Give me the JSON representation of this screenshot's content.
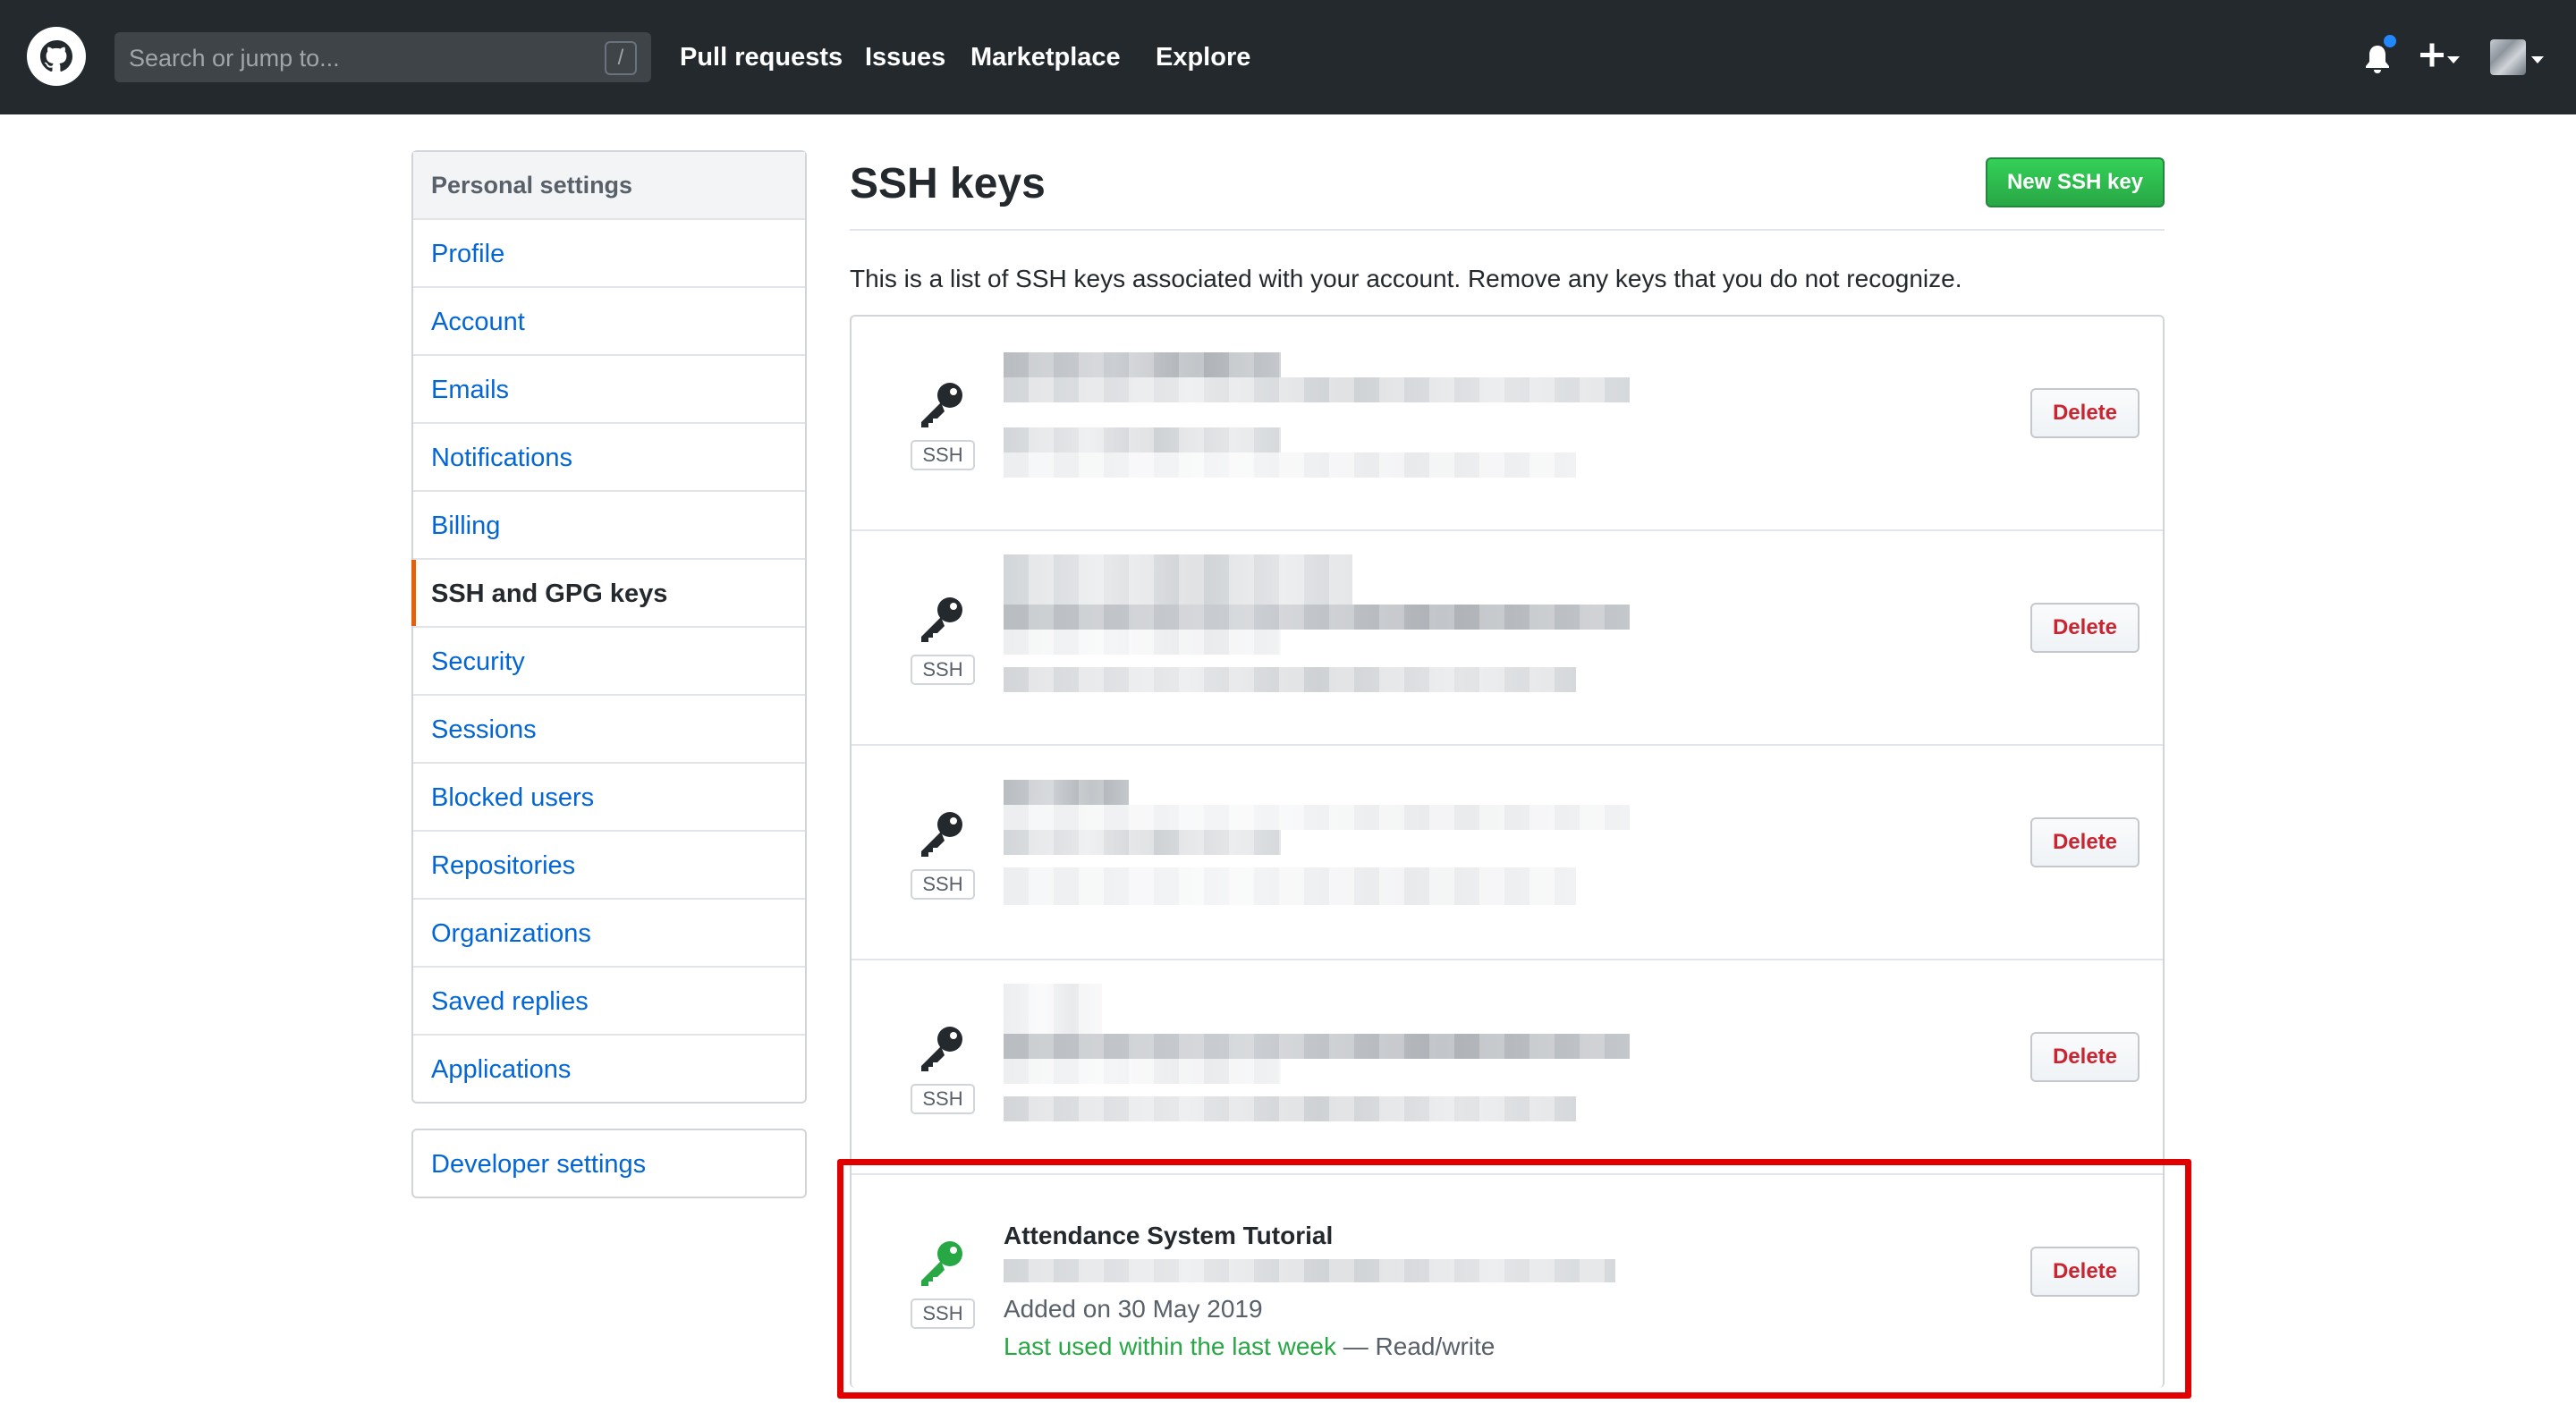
{
  "header": {
    "search_placeholder": "Search or jump to...",
    "search_shortcut": "/",
    "nav": [
      "Pull requests",
      "Issues",
      "Marketplace",
      "Explore"
    ]
  },
  "sidebar": {
    "heading": "Personal settings",
    "items": [
      {
        "label": "Profile"
      },
      {
        "label": "Account"
      },
      {
        "label": "Emails"
      },
      {
        "label": "Notifications"
      },
      {
        "label": "Billing"
      },
      {
        "label": "SSH and GPG keys",
        "active": true
      },
      {
        "label": "Security"
      },
      {
        "label": "Sessions"
      },
      {
        "label": "Blocked users"
      },
      {
        "label": "Repositories"
      },
      {
        "label": "Organizations"
      },
      {
        "label": "Saved replies"
      },
      {
        "label": "Applications"
      }
    ],
    "developer_settings": "Developer settings"
  },
  "main": {
    "title": "SSH keys",
    "new_key_button": "New SSH key",
    "intro": "This is a list of SSH keys associated with your account. Remove any keys that you do not recognize.",
    "keys": [
      {
        "type_label": "SSH",
        "delete_label": "Delete",
        "redacted": true
      },
      {
        "type_label": "SSH",
        "delete_label": "Delete",
        "redacted": true
      },
      {
        "type_label": "SSH",
        "delete_label": "Delete",
        "redacted": true
      },
      {
        "type_label": "SSH",
        "delete_label": "Delete",
        "redacted": true
      },
      {
        "type_label": "SSH",
        "delete_label": "Delete",
        "name": "Attendance System Tutorial",
        "added": "Added on 30 May 2019",
        "last_used": "Last used within the last week",
        "access": " — Read/write"
      }
    ]
  },
  "colors": {
    "header_bg": "#24292e",
    "link": "#0366d6",
    "active_marker": "#e36209",
    "primary_button": "#28a745",
    "danger": "#cb2431",
    "recent_key": "#28a745",
    "highlight_box": "#e00000",
    "notification_dot": "#2188ff"
  },
  "icons": {
    "logo": "github-octocat-icon",
    "bell": "bell-icon",
    "plus": "plus-icon",
    "key": "key-icon"
  }
}
